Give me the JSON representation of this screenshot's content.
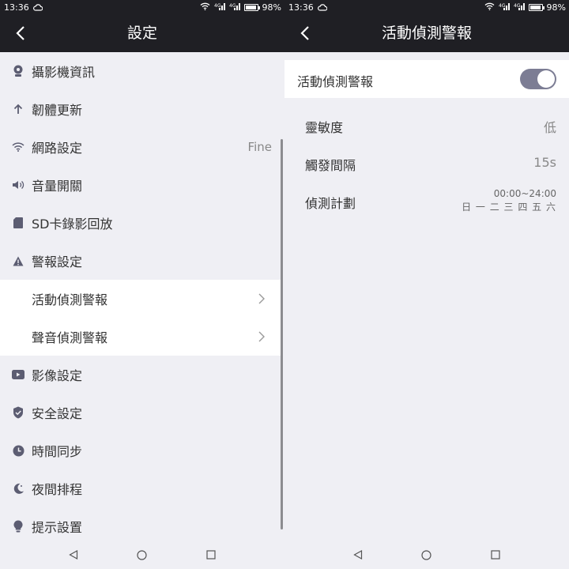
{
  "status_left": {
    "time": "13:36",
    "battery": "98%",
    "battery_level": 0.98
  },
  "status_right": {
    "time": "13:36",
    "battery": "98%",
    "battery_level": 0.98
  },
  "left": {
    "title": "設定",
    "items": [
      {
        "label": "攝影機資訊",
        "icon": "camera-icon"
      },
      {
        "label": "韌體更新",
        "icon": "arrow-up-icon"
      },
      {
        "label": "網路設定",
        "icon": "wifi-icon",
        "value": "Fine"
      },
      {
        "label": "音量開關",
        "icon": "speaker-icon"
      },
      {
        "label": "SD卡錄影回放",
        "icon": "sd-card-icon"
      },
      {
        "label": "警報設定",
        "icon": "warning-icon"
      },
      {
        "label": "活動偵測警報",
        "sub": true
      },
      {
        "label": "聲音偵測警報",
        "sub": true
      },
      {
        "label": "影像設定",
        "icon": "video-icon"
      },
      {
        "label": "安全設定",
        "icon": "shield-icon"
      },
      {
        "label": "時間同步",
        "icon": "clock-icon"
      },
      {
        "label": "夜間排程",
        "icon": "moon-icon"
      },
      {
        "label": "提示設置",
        "icon": "bulb-icon"
      }
    ]
  },
  "right": {
    "title": "活動偵測警報",
    "toggle": {
      "label": "活動偵測警報",
      "on": true
    },
    "rows": [
      {
        "label": "靈敏度",
        "value": "低"
      },
      {
        "label": "觸發間隔",
        "value": "15s"
      },
      {
        "label": "偵測計劃",
        "time_range": "00:00~24:00",
        "days": "日 一 二 三 四 五 六"
      }
    ]
  },
  "colors": {
    "appbar": "#1f1f24",
    "background": "#efeff4",
    "toggle_on": "#7c7d94"
  }
}
